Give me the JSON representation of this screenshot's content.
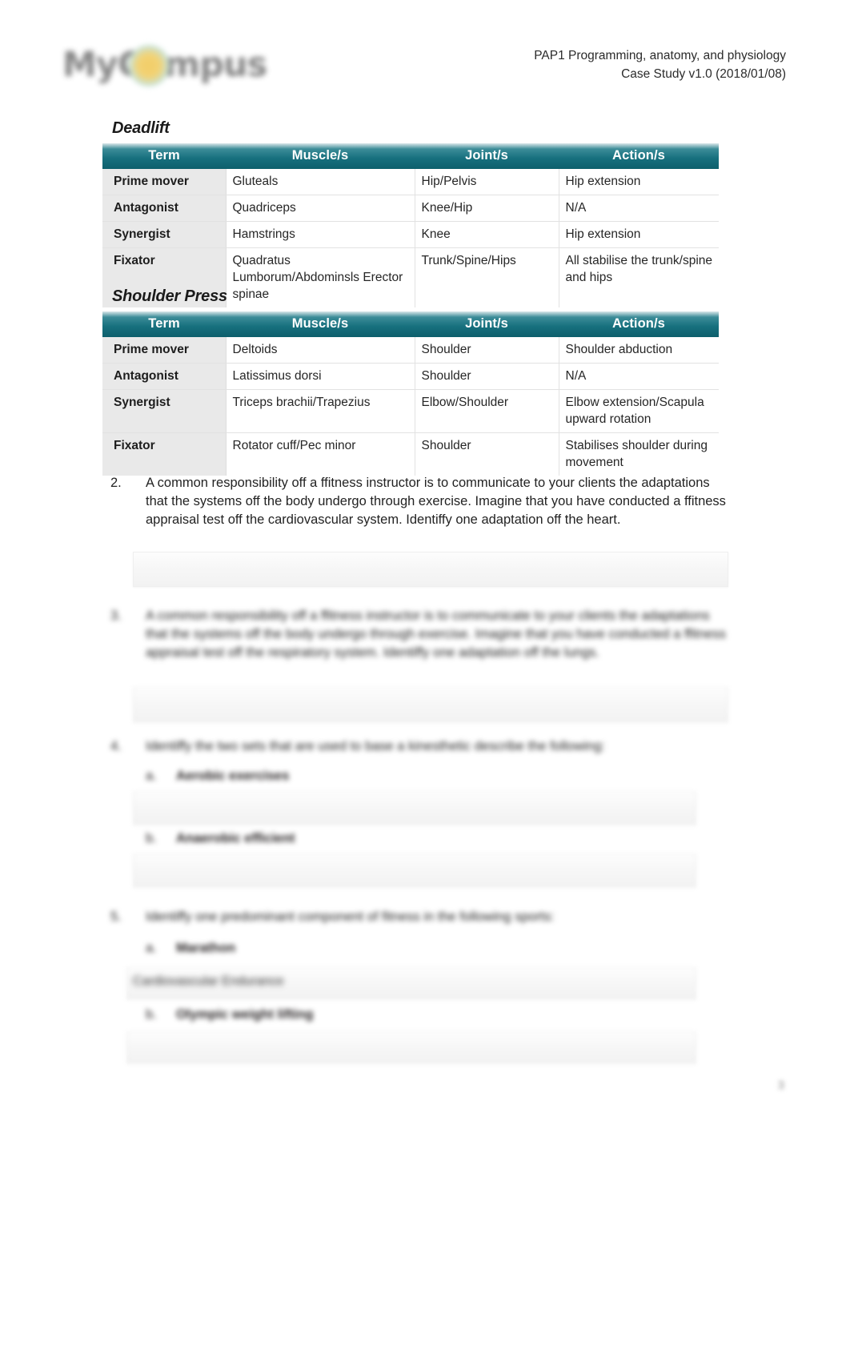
{
  "header": {
    "logo_text": "MyCampus",
    "line1": "PAP1 Programming, anatomy, and physiology",
    "line2": "Case Study v1.0 (2018/01/08)"
  },
  "sections": [
    {
      "title": "Deadlift",
      "columns": [
        "Term",
        "Muscle/s",
        "Joint/s",
        "Action/s"
      ],
      "rows": [
        {
          "term": "Prime mover",
          "muscle": "Gluteals",
          "joint": "Hip/Pelvis",
          "action": "Hip extension"
        },
        {
          "term": "Antagonist",
          "muscle": "Quadriceps",
          "joint": "Knee/Hip",
          "action": "N/A"
        },
        {
          "term": "Synergist",
          "muscle": "Hamstrings",
          "joint": "Knee",
          "action": "Hip extension"
        },
        {
          "term": "Fixator",
          "muscle": "Quadratus Lumborum/Abdominsls Erector spinae",
          "joint": "Trunk/Spine/Hips",
          "action": "All stabilise the trunk/spine and hips"
        }
      ]
    },
    {
      "title": "Shoulder Press",
      "columns": [
        "Term",
        "Muscle/s",
        "Joint/s",
        "Action/s"
      ],
      "rows": [
        {
          "term": "Prime mover",
          "muscle": "Deltoids",
          "joint": "Shoulder",
          "action": "Shoulder abduction"
        },
        {
          "term": "Antagonist",
          "muscle": "Latissimus dorsi",
          "joint": "Shoulder",
          "action": "N/A"
        },
        {
          "term": "Synergist",
          "muscle": "Triceps brachii/Trapezius",
          "joint": "Elbow/Shoulder",
          "action": "Elbow extension/Scapula upward rotation"
        },
        {
          "term": "Fixator",
          "muscle": "Rotator cuff/Pec minor",
          "joint": "Shoulder",
          "action": "Stabilises shoulder during movement"
        }
      ]
    }
  ],
  "questions": [
    {
      "number": "2.",
      "text": "A common responsibility off a ffitness instructor is to communicate to your clients the adaptations that the systems off the body undergo through exercise. Imagine that you have conducted a ffitness appraisal test off the cardiovascular system. Identiffy one adaptation off the heart."
    },
    {
      "number": "3.",
      "text": "A common responsibility off a ffitness instructor is to communicate to your clients the adaptations that the systems off the body undergo through exercise. Imagine that you have conducted a ffitness appraisal test off the respiratory system. Identiffy one adaptation off the lungs."
    },
    {
      "number": "4.",
      "text": "Identiffy the two sets that are used to base a kinesthetic describe the following:",
      "subitems": [
        {
          "letter": "a.",
          "label": "Aerobic exercises"
        },
        {
          "letter": "b.",
          "label": "Anaerobic efficient"
        }
      ]
    },
    {
      "number": "5.",
      "text": "Identiffy one predominant component of fitness in the following sports:",
      "subitems": [
        {
          "letter": "a.",
          "label": "Marathon",
          "answer": "Cardiovascular Endurance"
        },
        {
          "letter": "b.",
          "label": "Olympic weight lifting",
          "answer": ""
        }
      ]
    }
  ],
  "page_number": "3",
  "colors": {
    "table_header_teal": "#17707e",
    "term_column_gray": "#e9e9e9",
    "logo_gray": "#7b7b7b",
    "logo_sun_gold": "#f0c95a"
  }
}
